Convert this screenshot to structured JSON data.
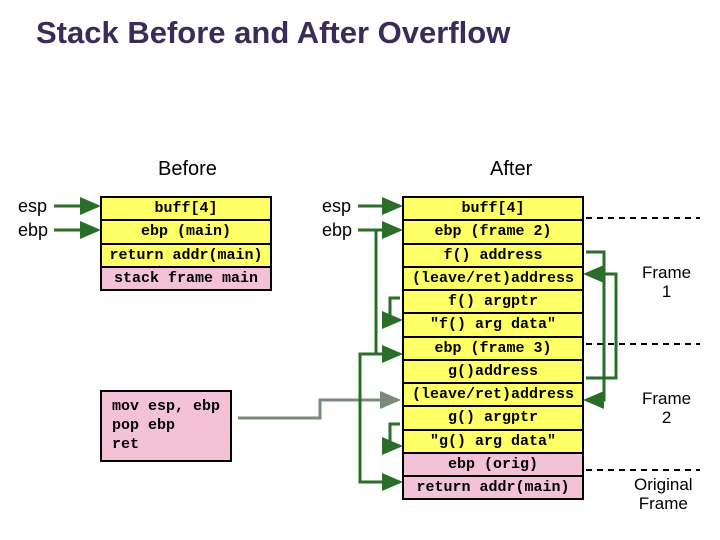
{
  "title": "Stack Before and After Overflow",
  "before": {
    "heading": "Before",
    "ptr_esp": "esp",
    "ptr_ebp": "ebp",
    "cells": [
      "buff[4]",
      "ebp (main)",
      "return addr(main)",
      "stack frame main"
    ]
  },
  "after": {
    "heading": "After",
    "ptr_esp": "esp",
    "ptr_ebp": "ebp",
    "cells": [
      "buff[4]",
      "ebp (frame 2)",
      "f() address",
      "(leave/ret)address",
      "f() argptr",
      "\"f() arg data\"",
      "ebp (frame 3)",
      "g()address",
      "(leave/ret)address",
      "g() argptr",
      "\"g() arg data\"",
      "ebp (orig)",
      "return addr(main)"
    ]
  },
  "code": "mov esp, ebp\npop ebp\nret",
  "frames": {
    "f1": "Frame\n1",
    "f2": "Frame\n2",
    "orig": "Original\nFrame"
  }
}
